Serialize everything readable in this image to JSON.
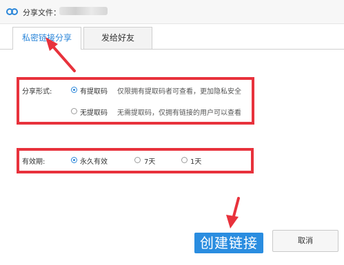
{
  "window": {
    "title": "分享文件："
  },
  "tabs": [
    {
      "label": "私密链接分享",
      "active": true
    },
    {
      "label": "发给好友",
      "active": false
    }
  ],
  "share_form": {
    "label": "分享形式:",
    "options": [
      {
        "label": "有提取码",
        "description": "仅限拥有提取码者可查看，更加隐私安全",
        "checked": true
      },
      {
        "label": "无提取码",
        "description": "无需提取码，仅拥有链接的用户可以查看",
        "checked": false
      }
    ]
  },
  "validity": {
    "label": "有效期:",
    "options": [
      {
        "label": "永久有效",
        "checked": true
      },
      {
        "label": "7天",
        "checked": false
      },
      {
        "label": "1天",
        "checked": false
      }
    ]
  },
  "buttons": {
    "create": "创建链接",
    "cancel": "取消"
  },
  "colors": {
    "accent": "#2b86d9",
    "annotation_red": "#e8323c",
    "create_button": "#2a8de0"
  }
}
